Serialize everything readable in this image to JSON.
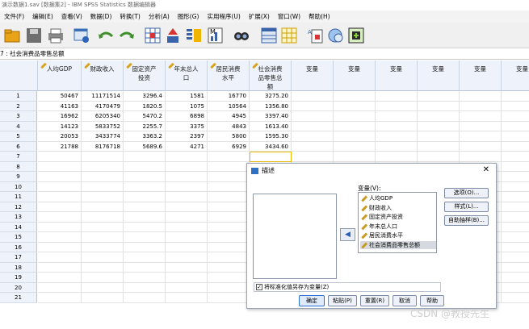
{
  "window": {
    "title": "演示数据1.sav [数据集2] - IBM SPSS Statistics 数据编辑器"
  },
  "menu": [
    "文件(F)",
    "编辑(E)",
    "查看(V)",
    "数据(D)",
    "转换(T)",
    "分析(A)",
    "图形(G)",
    "实用程序(U)",
    "扩展(X)",
    "窗口(W)",
    "帮助(H)"
  ],
  "toolbar": {
    "icons": [
      "open-icon",
      "save-icon",
      "print-icon",
      "recall-dialog-icon",
      "undo-icon",
      "redo-icon",
      "goto-case-icon",
      "goto-variable-icon",
      "variables-icon",
      "run-descriptive-icon",
      "find-icon",
      "insert-cases-icon",
      "insert-variable-icon",
      "split-file-icon",
      "value-labels-icon",
      "use-sets-icon"
    ]
  },
  "cellref": {
    "text": "7 : 社会消费品零售总额"
  },
  "grid": {
    "columns": [
      "人均GDP",
      "财政收入",
      "固定资产投资",
      "年末总人口",
      "居民消费水平",
      "社会消费品零售总额",
      "变量",
      "变量",
      "变量",
      "变量",
      "变量",
      "变量"
    ],
    "column_lines": [
      [
        "人均GDP"
      ],
      [
        "财政收入"
      ],
      [
        "固定资产",
        "投资"
      ],
      [
        "年末总人",
        "口"
      ],
      [
        "居民消费",
        "水平"
      ],
      [
        "社会消费",
        "品零售总",
        "额"
      ],
      [
        "变量"
      ],
      [
        "变量"
      ],
      [
        "变量"
      ],
      [
        "变量"
      ],
      [
        "变量"
      ],
      [
        "变量"
      ]
    ],
    "rows": [
      [
        "50467",
        "11171514",
        "3296.4",
        "1581",
        "16770",
        "3275.20"
      ],
      [
        "41163",
        "4170479",
        "1820.5",
        "1075",
        "10564",
        "1356.80"
      ],
      [
        "16962",
        "6205340",
        "5470.2",
        "6898",
        "4945",
        "3397.40"
      ],
      [
        "14123",
        "5833752",
        "2255.7",
        "3375",
        "4843",
        "1613.40"
      ],
      [
        "20053",
        "3433774",
        "3363.2",
        "2397",
        "5800",
        "1595.30"
      ],
      [
        "21788",
        "8176718",
        "5689.6",
        "4271",
        "6929",
        "3434.60"
      ]
    ],
    "row_numbers": [
      "1",
      "2",
      "3",
      "4",
      "5",
      "6",
      "7",
      "8",
      "9",
      "10",
      "11",
      "12",
      "13",
      "14",
      "15",
      "16",
      "17",
      "18",
      "19",
      "20",
      "21"
    ]
  },
  "dialog": {
    "title": "描述",
    "variables_label": "变量(V):",
    "variables": [
      "人均GDP",
      "财政收入",
      "固定资产投资",
      "年末总人口",
      "居民消费水平",
      "社会消费品零售总额"
    ],
    "selected_variable": "社会消费品零售总额",
    "side_buttons": [
      "选项(O)...",
      "样式(L)...",
      "自助抽样(B)..."
    ],
    "checkbox_label": "将标准化值另存为变量(Z)",
    "checkbox_checked": true,
    "bottom_buttons": [
      "确定",
      "粘贴(P)",
      "重置(R)",
      "取消",
      "帮助"
    ]
  },
  "watermark": "CSDN @教授先生"
}
